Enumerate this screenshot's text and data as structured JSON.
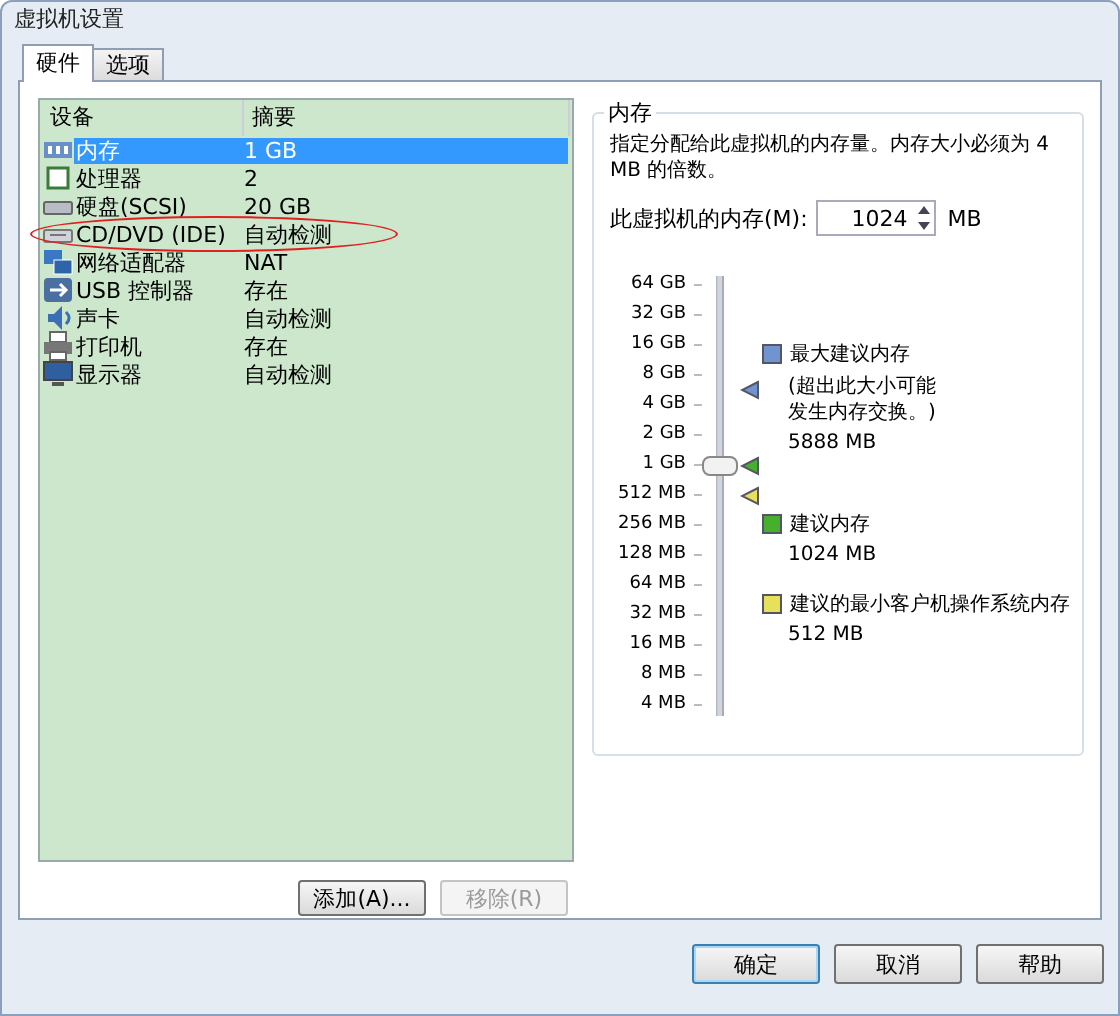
{
  "window": {
    "title": "虚拟机设置"
  },
  "tabs": [
    {
      "label": "硬件",
      "selected": true
    },
    {
      "label": "选项",
      "selected": false
    }
  ],
  "devices": {
    "columns": [
      "设备",
      "摘要"
    ],
    "rows": [
      {
        "kind": "memory",
        "name": "内存",
        "summary": "1 GB",
        "selected": true,
        "circled": false
      },
      {
        "kind": "cpu",
        "name": "处理器",
        "summary": "2",
        "selected": false,
        "circled": false
      },
      {
        "kind": "disk",
        "name": "硬盘(SCSI)",
        "summary": "20 GB",
        "selected": false,
        "circled": false
      },
      {
        "kind": "cd",
        "name": "CD/DVD (IDE)",
        "summary": "自动检测",
        "selected": false,
        "circled": true
      },
      {
        "kind": "network",
        "name": "网络适配器",
        "summary": "NAT",
        "selected": false,
        "circled": false
      },
      {
        "kind": "usb",
        "name": "USB 控制器",
        "summary": "存在",
        "selected": false,
        "circled": false
      },
      {
        "kind": "sound",
        "name": "声卡",
        "summary": "自动检测",
        "selected": false,
        "circled": false
      },
      {
        "kind": "printer",
        "name": "打印机",
        "summary": "存在",
        "selected": false,
        "circled": false
      },
      {
        "kind": "display",
        "name": "显示器",
        "summary": "自动检测",
        "selected": false,
        "circled": false
      }
    ],
    "buttons": [
      {
        "label": "添加(A)...",
        "disabled": false
      },
      {
        "label": "移除(R)",
        "disabled": true
      }
    ]
  },
  "memory": {
    "title": "内存",
    "description": "指定分配给此虚拟机的内存量。内存大小必须为 4 MB 的倍数。",
    "field_label": "此虚拟机的内存(M):",
    "value": "1024",
    "unit": "MB",
    "scale": [
      "64 GB",
      "32 GB",
      "16 GB",
      "8 GB",
      "4 GB",
      "2 GB",
      "1 GB",
      "512 MB",
      "256 MB",
      "128 MB",
      "64 MB",
      "32 MB",
      "16 MB",
      "8 MB",
      "4 MB"
    ],
    "slider": {
      "level": 0.571
    },
    "legend": [
      {
        "label": "最大建议内存",
        "note": "(超出此大小可能发生内存交换。)",
        "value": "5888 MB",
        "color": "#6f94cf",
        "level": 0.751
      },
      {
        "label": "建议内存",
        "value": "1024 MB",
        "color": "#44b02c",
        "level": 0.571
      },
      {
        "label": "建议的最小客户机操作系统内存",
        "value": "512 MB",
        "color": "#e6e05a",
        "level": 0.5
      }
    ]
  },
  "footer_buttons": [
    {
      "label": "确定",
      "default": true
    },
    {
      "label": "取消",
      "default": false
    },
    {
      "label": "帮助",
      "default": false
    }
  ]
}
